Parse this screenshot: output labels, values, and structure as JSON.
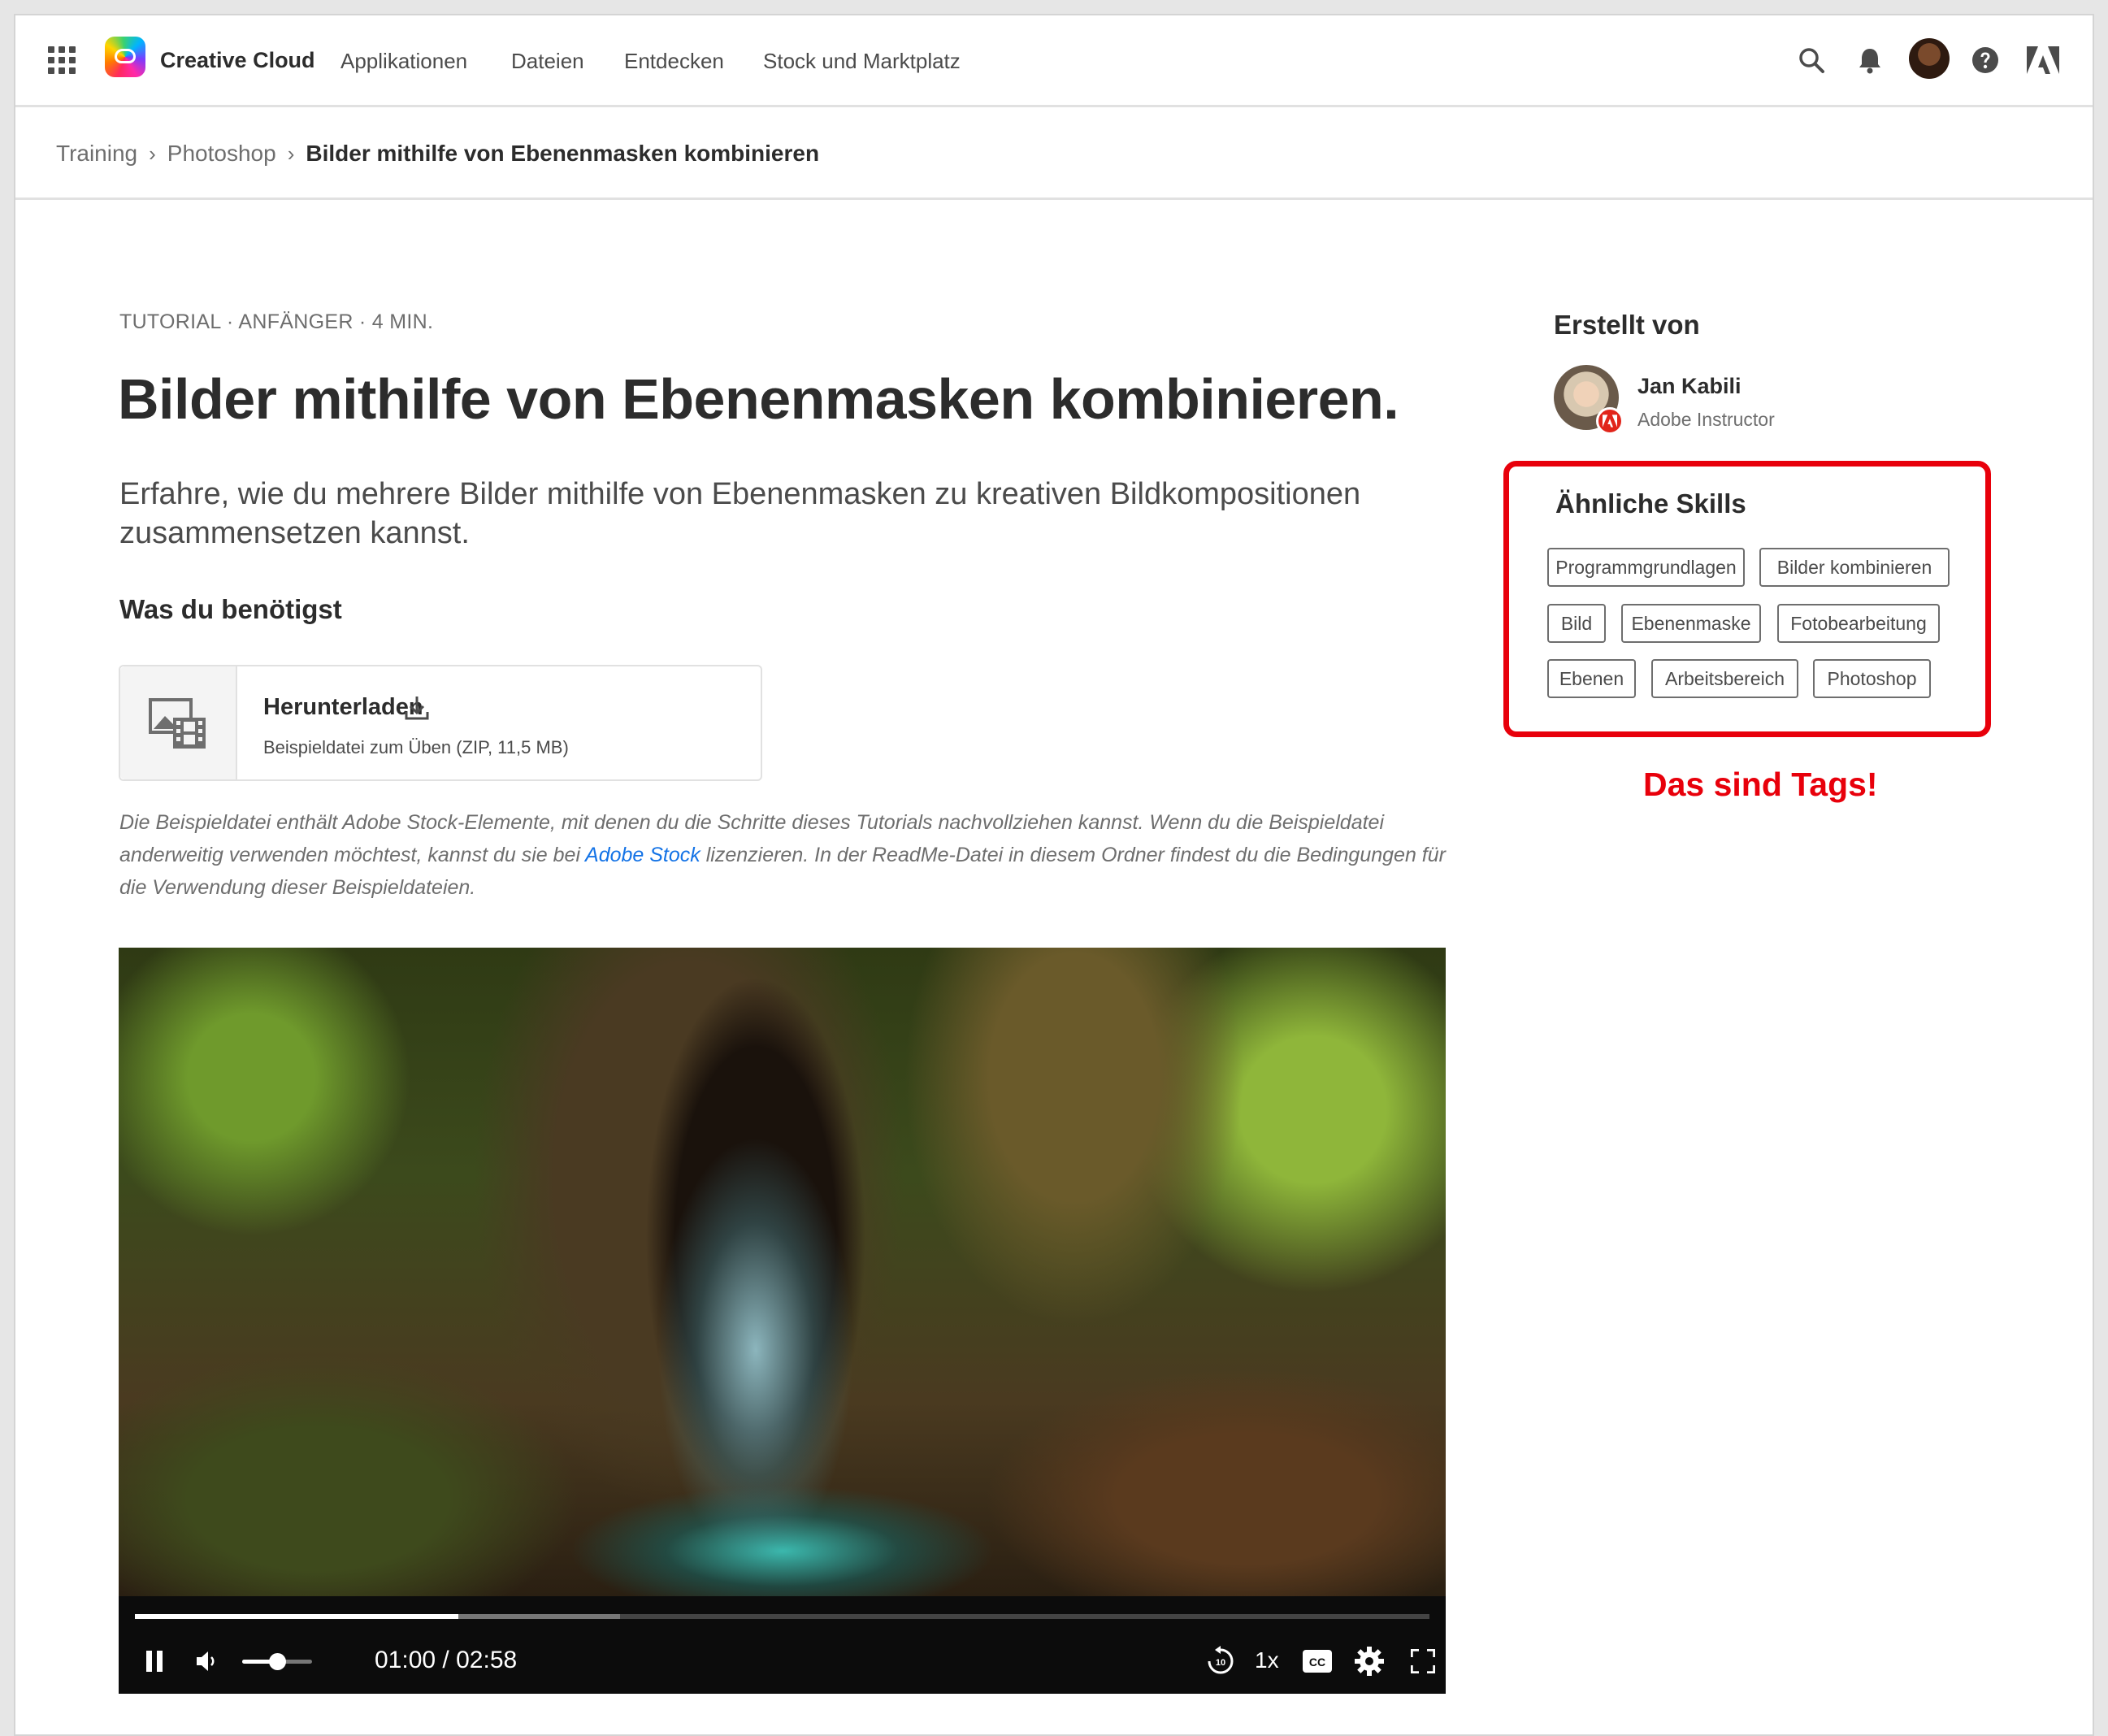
{
  "header": {
    "brand": "Creative Cloud",
    "nav": [
      "Applikationen",
      "Dateien",
      "Entdecken",
      "Stock und Marktplatz"
    ],
    "icons": [
      "apps-grid-icon",
      "search-icon",
      "bell-icon",
      "avatar",
      "help-icon",
      "adobe-logo-icon"
    ]
  },
  "breadcrumb": {
    "items": [
      "Training",
      "Photoshop"
    ],
    "current": "Bilder mithilfe von Ebenenmasken kombinieren"
  },
  "article": {
    "meta": "TUTORIAL · ANFÄNGER · 4 MIN.",
    "title": "Bilder mithilfe von Ebenenmasken kombinieren.",
    "intro": "Erfahre, wie du mehrere Bilder mithilfe von Ebenenmasken zu kreativen Bildkompositionen zusammensetzen kannst.",
    "needs_heading": "Was du benötigst",
    "download": {
      "title": "Herunterladen",
      "subtitle": "Beispieldatei zum Üben (ZIP, 11,5 MB)"
    },
    "note_before": "Die Beispieldatei enthält Adobe Stock-Elemente, mit denen du die Schritte dieses Tutorials nachvollziehen kannst. Wenn du die Beispieldatei anderweitig verwenden möchtest, kannst du sie bei ",
    "note_link": "Adobe Stock",
    "note_after": " lizenzieren. In der ReadMe-Datei in diesem Ordner findest du die Bedingungen für die Verwendung dieser Beispieldateien."
  },
  "video": {
    "current_time": "01:00",
    "separator": "/",
    "duration": "02:58",
    "progress": 0.25,
    "buffered": 0.375,
    "volume": 0.5,
    "speed": "1x",
    "colors": {
      "progress": "#ffffff",
      "track": "#444444",
      "bar": "#0c0c0c"
    }
  },
  "sidebar": {
    "created_by_label": "Erstellt von",
    "author_name": "Jan Kabili",
    "author_role": "Adobe Instructor",
    "skills_title": "Ähnliche Skills",
    "tags": [
      "Programmgrundlagen",
      "Bilder kombinieren",
      "Bild",
      "Ebenenmaske",
      "Fotobearbeitung",
      "Ebenen",
      "Arbeitsbereich",
      "Photoshop"
    ],
    "annotation": "Das sind Tags!",
    "highlight_color": "#e8000b"
  }
}
